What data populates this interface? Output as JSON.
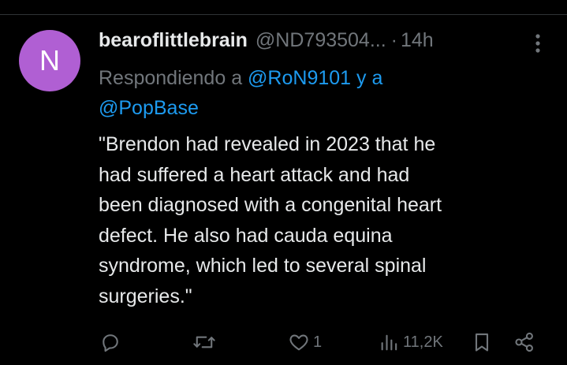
{
  "author": {
    "avatar_initial": "N",
    "avatar_color": "#b05fd3",
    "display_name": "bearoflittlebrain",
    "handle": "@ND793504...",
    "separator": "·",
    "time": "14h"
  },
  "reply_context": {
    "prefix": "Respondiendo a ",
    "mention_1": "@RoN9101",
    "joiner": " y a ",
    "mention_2": "@PopBase"
  },
  "post": {
    "lines": [
      "\"Brendon had revealed in 2023 that he",
      "had suffered a heart attack and had",
      "been diagnosed with a congenital heart",
      "defect. He also had cauda equina",
      "syndrome, which led to several spinal",
      "surgeries.\""
    ]
  },
  "actions": {
    "reply": {
      "icon": "reply-icon"
    },
    "repost": {
      "icon": "repost-icon"
    },
    "like": {
      "icon": "heart-icon",
      "count": "1"
    },
    "views": {
      "icon": "views-icon",
      "count": "11,2K"
    },
    "bookmark": {
      "icon": "bookmark-icon"
    },
    "share": {
      "icon": "share-icon"
    }
  },
  "colors": {
    "background": "#000000",
    "text": "#e7e9ea",
    "muted": "#71767b",
    "link": "#1d9bf0"
  }
}
